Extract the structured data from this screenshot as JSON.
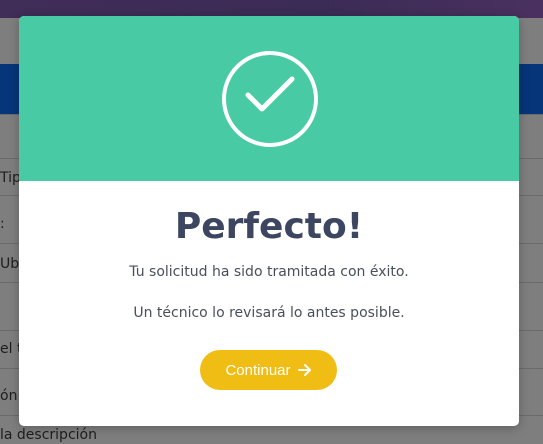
{
  "background": {
    "rows": [
      "Tip",
      ":",
      "Ub",
      "el t",
      "ón:",
      "la descripción"
    ]
  },
  "modal": {
    "title": "Perfecto!",
    "message_line1": "Tu solicitud ha sido tramitada con éxito.",
    "message_line2": "Un técnico lo revisará lo antes posible.",
    "continue_label": "Continuar",
    "icon": "check-circle-icon",
    "colors": {
      "header": "#48cba4",
      "button": "#f0bd14",
      "title": "#3d4660"
    }
  }
}
